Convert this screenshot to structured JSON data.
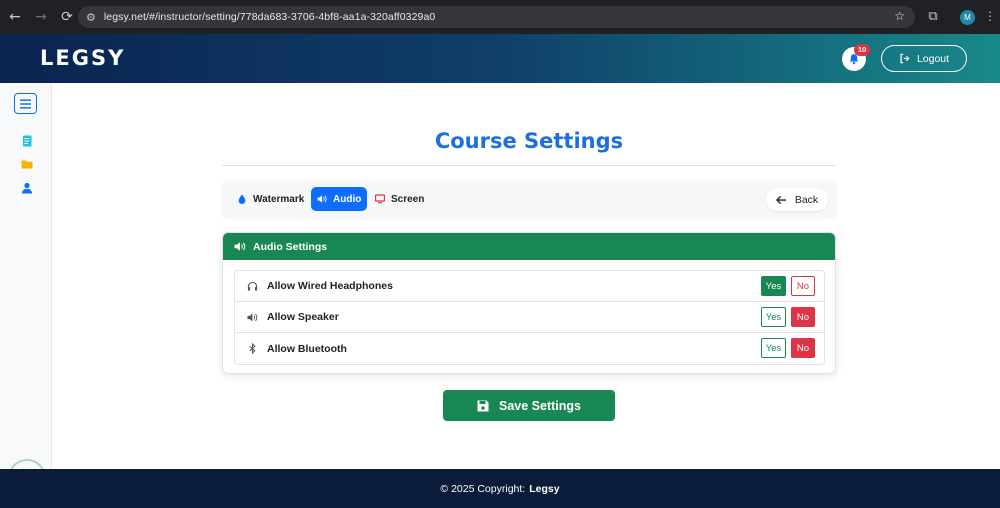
{
  "browser": {
    "url": "legsy.net/#/instructor/setting/778da683-3706-4bf8-aa1a-320aff0329a0",
    "profile_initial": "M"
  },
  "header": {
    "brand": "LEGSY",
    "notification_count": "10",
    "logout_label": "Logout"
  },
  "sidebar": {
    "icons": [
      "menu-icon",
      "notebook-icon",
      "folder-icon",
      "user-icon"
    ]
  },
  "page": {
    "title": "Course Settings"
  },
  "tabs": {
    "items": [
      {
        "label": "Watermark",
        "icon": "droplet-icon",
        "active": false
      },
      {
        "label": "Audio",
        "icon": "volume-icon",
        "active": true
      },
      {
        "label": "Screen",
        "icon": "monitor-icon",
        "active": false
      }
    ],
    "back_label": "Back"
  },
  "audio_settings": {
    "title": "Audio Settings",
    "rows": [
      {
        "label": "Allow Wired Headphones",
        "icon": "headphones-icon",
        "value": "Yes"
      },
      {
        "label": "Allow Speaker",
        "icon": "speaker-icon",
        "value": "No"
      },
      {
        "label": "Allow Bluetooth",
        "icon": "bluetooth-icon",
        "value": "No"
      }
    ],
    "yes_label": "Yes",
    "no_label": "No"
  },
  "save_label": "Save Settings",
  "footer": {
    "copyright": "© 2025 Copyright:",
    "brand": "Legsy"
  },
  "colors": {
    "primary": "#0d6efd",
    "success": "#198754",
    "danger": "#dc3545",
    "title": "#1d6fe0",
    "footer": "#0b1b3a"
  }
}
